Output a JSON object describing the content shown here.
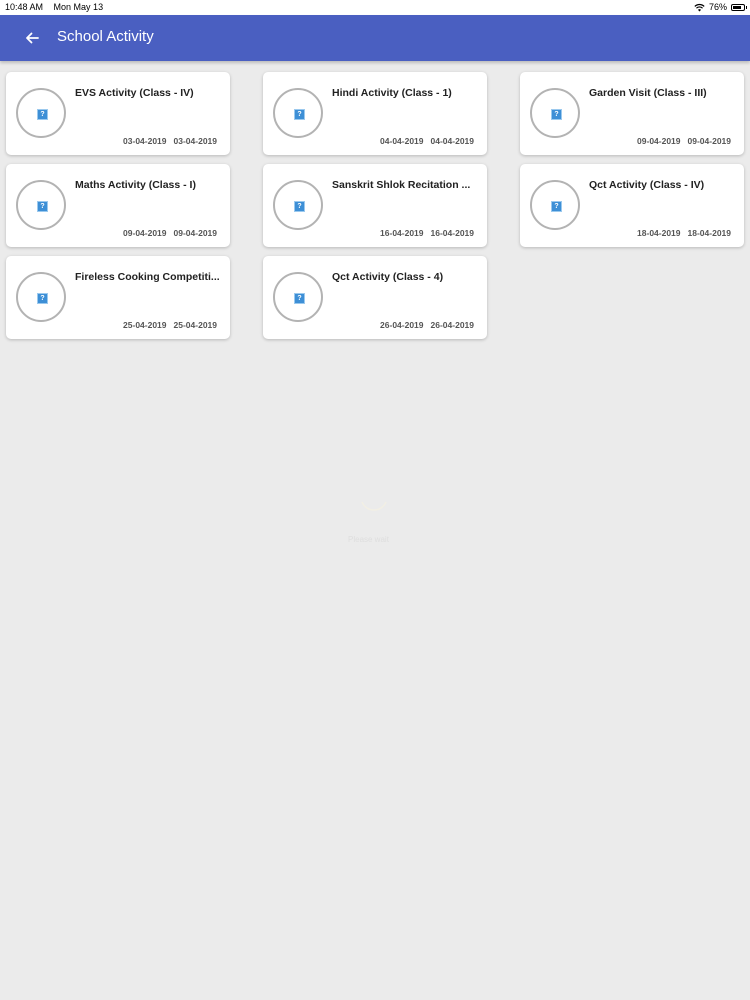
{
  "status_bar": {
    "time": "10:48 AM",
    "date": "Mon May 13",
    "battery_percent": "76%",
    "battery_level": 0.76
  },
  "app_bar": {
    "title": "School Activity",
    "back_icon": "arrow-back-icon",
    "color": "#4a5fc1"
  },
  "activities": [
    {
      "title": "EVS Activity (Class - IV)",
      "start_date": "03-04-2019",
      "end_date": "03-04-2019"
    },
    {
      "title": "Hindi Activity (Class - 1)",
      "start_date": "04-04-2019",
      "end_date": "04-04-2019"
    },
    {
      "title": "Garden Visit (Class - III)",
      "start_date": "09-04-2019",
      "end_date": "09-04-2019"
    },
    {
      "title": "Maths Activity (Class - I)",
      "start_date": "09-04-2019",
      "end_date": "09-04-2019"
    },
    {
      "title": "Sanskrit Shlok Recitation ...",
      "start_date": "16-04-2019",
      "end_date": "16-04-2019"
    },
    {
      "title": "Qct Activity (Class - IV)",
      "start_date": "18-04-2019",
      "end_date": "18-04-2019"
    },
    {
      "title": "Fireless Cooking Competiti...",
      "start_date": "25-04-2019",
      "end_date": "25-04-2019"
    },
    {
      "title": "Qct Activity (Class - 4)",
      "start_date": "26-04-2019",
      "end_date": "26-04-2019"
    }
  ],
  "loader": {
    "text": "Please wait"
  }
}
